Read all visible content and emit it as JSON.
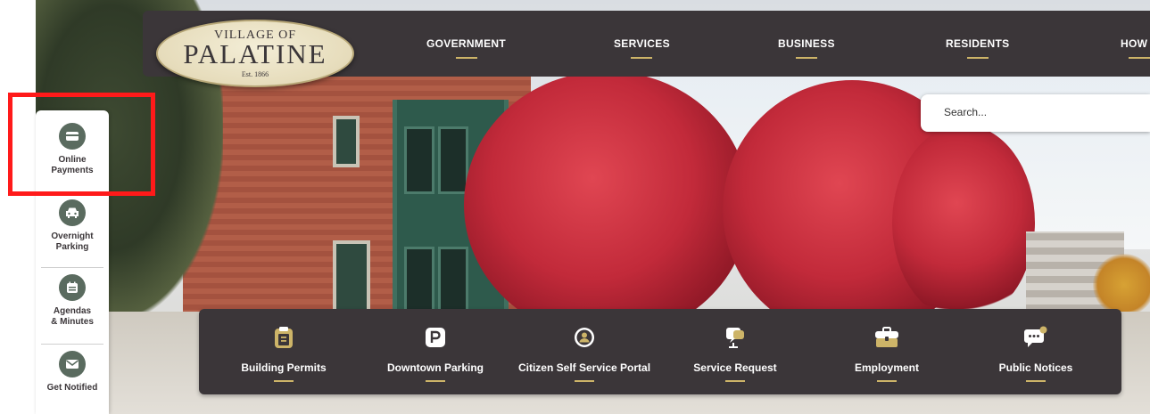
{
  "logo": {
    "line1": "VILLAGE OF",
    "line2": "PALATINE",
    "line3": "Est. 1866"
  },
  "nav": {
    "items": [
      {
        "label": "GOVERNMENT"
      },
      {
        "label": "SERVICES"
      },
      {
        "label": "BUSINESS"
      },
      {
        "label": "RESIDENTS"
      },
      {
        "label": "HOW D"
      }
    ]
  },
  "search": {
    "placeholder": "Search..."
  },
  "sidebar": {
    "items": [
      {
        "label_line1": "Online",
        "label_line2": "Payments",
        "icon": "card-icon"
      },
      {
        "label_line1": "Overnight",
        "label_line2": "Parking",
        "icon": "car-icon"
      },
      {
        "label_line1": "Agendas",
        "label_line2": "& Minutes",
        "icon": "calendar-icon"
      },
      {
        "label_line1": "Get Notified",
        "label_line2": "",
        "icon": "envelope-icon"
      }
    ]
  },
  "quick_links": [
    {
      "label": "Building Permits",
      "icon": "permit-icon"
    },
    {
      "label": "Downtown Parking",
      "icon": "parking-icon"
    },
    {
      "label": "Citizen Self Service Portal",
      "icon": "user-circle-icon"
    },
    {
      "label": "Service Request",
      "icon": "chat-monitor-icon"
    },
    {
      "label": "Employment",
      "icon": "briefcase-icon"
    },
    {
      "label": "Public Notices",
      "icon": "notice-bubble-icon"
    }
  ],
  "colors": {
    "nav_bg": "#3b3639",
    "accent_gold": "#cdb468",
    "sidebar_icon": "#5a6b5f",
    "highlight": "#ff1a1a"
  }
}
